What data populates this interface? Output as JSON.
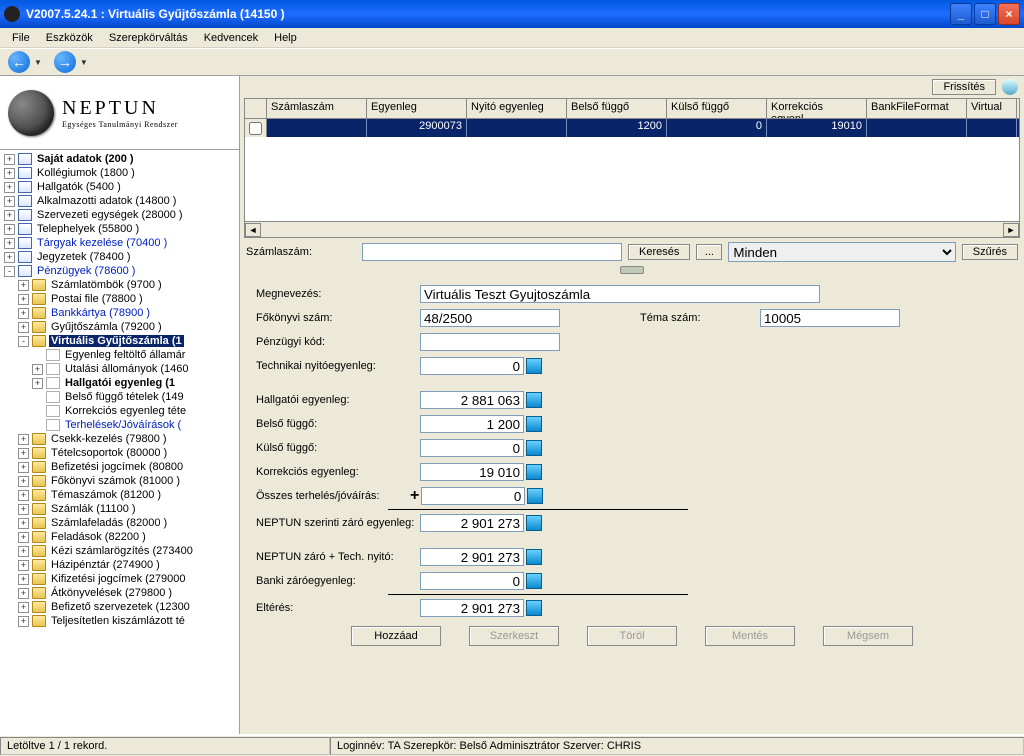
{
  "window": {
    "title": "V2007.5.24.1 : Virtuális Gyűjtőszámla (14150  )"
  },
  "menu": [
    "File",
    "Eszközök",
    "Szerepkörváltás",
    "Kedvencek",
    "Help"
  ],
  "logo": {
    "name": "NEPTUN",
    "tagline": "Egységes Tanulmányi Rendszer"
  },
  "tree": [
    {
      "lvl": 0,
      "pm": "+",
      "icon": "book",
      "bold": true,
      "blue": false,
      "cur": false,
      "label": "Saját adatok (200  )"
    },
    {
      "lvl": 0,
      "pm": "+",
      "icon": "book",
      "bold": false,
      "blue": false,
      "cur": false,
      "label": "Kollégiumok (1800  )"
    },
    {
      "lvl": 0,
      "pm": "+",
      "icon": "book",
      "bold": false,
      "blue": false,
      "cur": false,
      "label": "Hallgatók (5400  )"
    },
    {
      "lvl": 0,
      "pm": "+",
      "icon": "book",
      "bold": false,
      "blue": false,
      "cur": false,
      "label": "Alkalmazotti adatok (14800  )"
    },
    {
      "lvl": 0,
      "pm": "+",
      "icon": "book",
      "bold": false,
      "blue": false,
      "cur": false,
      "label": "Szervezeti egységek (28000  )"
    },
    {
      "lvl": 0,
      "pm": "+",
      "icon": "book",
      "bold": false,
      "blue": false,
      "cur": false,
      "label": "Telephelyek (55800  )"
    },
    {
      "lvl": 0,
      "pm": "+",
      "icon": "book",
      "bold": false,
      "blue": true,
      "cur": false,
      "label": "Tárgyak kezelése (70400  )"
    },
    {
      "lvl": 0,
      "pm": "+",
      "icon": "book",
      "bold": false,
      "blue": false,
      "cur": false,
      "label": "Jegyzetek (78400  )"
    },
    {
      "lvl": 0,
      "pm": "-",
      "icon": "book",
      "bold": false,
      "blue": true,
      "cur": false,
      "label": "Pénzügyek (78600  )"
    },
    {
      "lvl": 1,
      "pm": "+",
      "icon": "folder",
      "bold": false,
      "blue": false,
      "cur": false,
      "label": "Számlatömbök (9700  )"
    },
    {
      "lvl": 1,
      "pm": "+",
      "icon": "folder",
      "bold": false,
      "blue": false,
      "cur": false,
      "label": "Postai file (78800  )"
    },
    {
      "lvl": 1,
      "pm": "+",
      "icon": "folder",
      "bold": false,
      "blue": true,
      "cur": false,
      "label": "Bankkártya (78900  )"
    },
    {
      "lvl": 1,
      "pm": "+",
      "icon": "folder",
      "bold": false,
      "blue": false,
      "cur": false,
      "label": "Gyűjtőszámla (79200  )"
    },
    {
      "lvl": 1,
      "pm": "-",
      "icon": "folder",
      "bold": true,
      "blue": false,
      "cur": true,
      "label": "Virtuális Gyűjtőszámla (1"
    },
    {
      "lvl": 2,
      "pm": " ",
      "icon": "page",
      "bold": false,
      "blue": false,
      "cur": false,
      "label": "Egyenleg feltöltő államár"
    },
    {
      "lvl": 2,
      "pm": "+",
      "icon": "page",
      "bold": false,
      "blue": false,
      "cur": false,
      "label": "Utalási állományok (1460"
    },
    {
      "lvl": 2,
      "pm": "+",
      "icon": "page",
      "bold": true,
      "blue": false,
      "cur": false,
      "label": "Hallgatói egyenleg  (1"
    },
    {
      "lvl": 2,
      "pm": " ",
      "icon": "page",
      "bold": false,
      "blue": false,
      "cur": false,
      "label": "Belső függő tételek (149"
    },
    {
      "lvl": 2,
      "pm": " ",
      "icon": "page",
      "bold": false,
      "blue": false,
      "cur": false,
      "label": "Korrekciós egyenleg téte"
    },
    {
      "lvl": 2,
      "pm": " ",
      "icon": "page",
      "bold": false,
      "blue": true,
      "cur": false,
      "label": "Terhelések/Jóváírások ("
    },
    {
      "lvl": 1,
      "pm": "+",
      "icon": "folder",
      "bold": false,
      "blue": false,
      "cur": false,
      "label": "Csekk-kezelés (79800  )"
    },
    {
      "lvl": 1,
      "pm": "+",
      "icon": "folder",
      "bold": false,
      "blue": false,
      "cur": false,
      "label": "Tételcsoportok (80000  )"
    },
    {
      "lvl": 1,
      "pm": "+",
      "icon": "folder",
      "bold": false,
      "blue": false,
      "cur": false,
      "label": "Befizetési jogcímek (80800"
    },
    {
      "lvl": 1,
      "pm": "+",
      "icon": "folder",
      "bold": false,
      "blue": false,
      "cur": false,
      "label": "Főkönyvi számok (81000  )"
    },
    {
      "lvl": 1,
      "pm": "+",
      "icon": "folder",
      "bold": false,
      "blue": false,
      "cur": false,
      "label": "Témaszámok (81200  )"
    },
    {
      "lvl": 1,
      "pm": "+",
      "icon": "folder",
      "bold": false,
      "blue": false,
      "cur": false,
      "label": "Számlák (11100  )"
    },
    {
      "lvl": 1,
      "pm": "+",
      "icon": "folder",
      "bold": false,
      "blue": false,
      "cur": false,
      "label": "Számlafeladás (82000  )"
    },
    {
      "lvl": 1,
      "pm": "+",
      "icon": "folder",
      "bold": false,
      "blue": false,
      "cur": false,
      "label": "Feladások (82200  )"
    },
    {
      "lvl": 1,
      "pm": "+",
      "icon": "folder",
      "bold": false,
      "blue": false,
      "cur": false,
      "label": "Kézi számlarögzítés (273400"
    },
    {
      "lvl": 1,
      "pm": "+",
      "icon": "folder",
      "bold": false,
      "blue": false,
      "cur": false,
      "label": "Házipénztár (274900  )"
    },
    {
      "lvl": 1,
      "pm": "+",
      "icon": "folder",
      "bold": false,
      "blue": false,
      "cur": false,
      "label": "Kifizetési jogcímek (279000"
    },
    {
      "lvl": 1,
      "pm": "+",
      "icon": "folder",
      "bold": false,
      "blue": false,
      "cur": false,
      "label": "Átkönyvelések (279800  )"
    },
    {
      "lvl": 1,
      "pm": "+",
      "icon": "folder",
      "bold": false,
      "blue": false,
      "cur": false,
      "label": "Befizető szervezetek (12300"
    },
    {
      "lvl": 1,
      "pm": "+",
      "icon": "folder",
      "bold": false,
      "blue": false,
      "cur": false,
      "label": "Teljesítetlen kiszámlázott té"
    }
  ],
  "grid": {
    "refresh": "Frissítés",
    "headers": [
      "Számlaszám",
      "Egyenleg",
      "Nyitó egyenleg",
      "Belső függő",
      "Külső függő",
      "Korrekciós egyenl...",
      "BankFileFormat",
      "Virtual"
    ],
    "row": [
      "",
      "2900073",
      "",
      "1200",
      "0",
      "19010",
      "",
      ""
    ]
  },
  "search": {
    "label": "Számlaszám:",
    "value": "",
    "search_btn": "Keresés",
    "more_btn": "...",
    "sel": "Minden",
    "filter_btn": "Szűrés"
  },
  "form": {
    "megnevezes_lbl": "Megnevezés:",
    "megnevezes": "Virtuális Teszt Gyujtoszámla",
    "fokonyvi_lbl": "Főkönyvi szám:",
    "fokonyvi": "48/2500",
    "tema_lbl": "Téma szám:",
    "tema": "10005",
    "penzugyi_lbl": "Pénzügyi kód:",
    "penzugyi": "",
    "technikai_lbl": "Technikai nyitóegyenleg:",
    "technikai": "0",
    "hallgatoi_lbl": "Hallgatói egyenleg:",
    "hallgatoi": "2 881 063",
    "belso_lbl": "Belső függő:",
    "belso": "1 200",
    "kulso_lbl": "Külső függő:",
    "kulso": "0",
    "korr_lbl": "Korrekciós egyenleg:",
    "korr": "19 010",
    "osszes_lbl": "Összes terhelés/jóváírás:",
    "osszes": "0",
    "neptun_zaro_lbl": "NEPTUN szerinti záró egyenleg:",
    "neptun_zaro": "2 901 273",
    "neptun_tech_lbl": "NEPTUN záró + Tech. nyitó:",
    "neptun_tech": "2 901 273",
    "banki_lbl": "Banki záróegyenleg:",
    "banki": "0",
    "elteres_lbl": "Eltérés:",
    "elteres": "2 901 273"
  },
  "buttons": {
    "add": "Hozzáad",
    "edit": "Szerkeszt",
    "del": "Töröl",
    "save": "Mentés",
    "cancel": "Mégsem"
  },
  "status": {
    "left": "Letöltve 1 / 1 rekord.",
    "right": "Loginnév: TA    Szerepkör: Belső Adminisztrátor    Szerver: CHRIS"
  }
}
